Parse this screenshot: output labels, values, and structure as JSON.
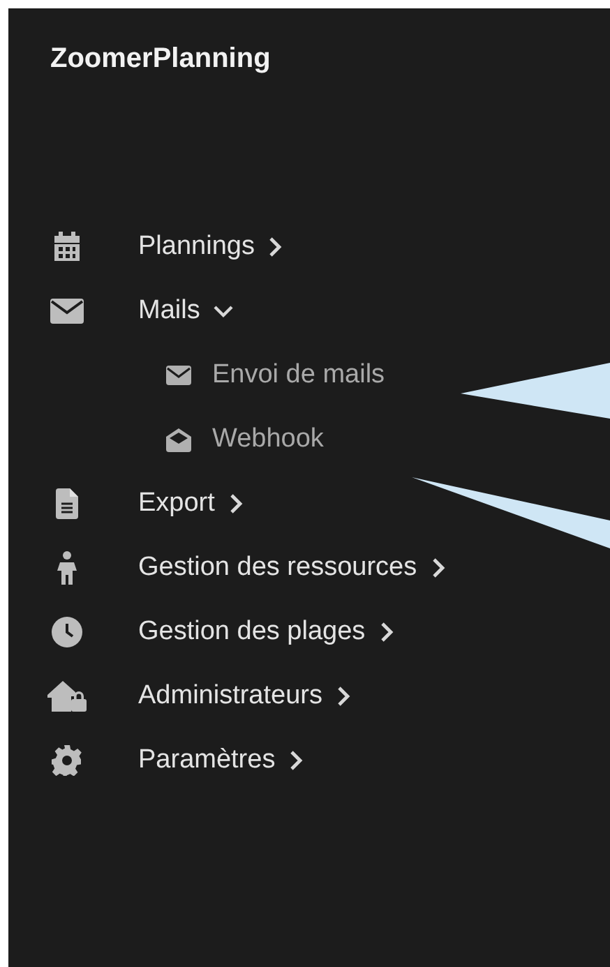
{
  "sidebar": {
    "title": "ZoomerPlanning",
    "items": [
      {
        "label": "Plannings",
        "expanded": false
      },
      {
        "label": "Mails",
        "expanded": true,
        "children": [
          {
            "label": "Envoi de mails"
          },
          {
            "label": "Webhook"
          }
        ]
      },
      {
        "label": "Export",
        "expanded": false
      },
      {
        "label": "Gestion des ressources",
        "expanded": false
      },
      {
        "label": "Gestion des plages",
        "expanded": false
      },
      {
        "label": "Administrateurs",
        "expanded": false
      },
      {
        "label": "Paramètres",
        "expanded": false
      }
    ]
  }
}
